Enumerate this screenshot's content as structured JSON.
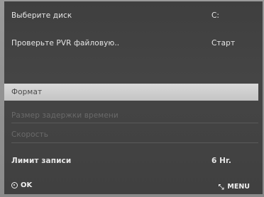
{
  "menu": {
    "rows": [
      {
        "label": "Выберите диск",
        "value": "C:"
      },
      {
        "label": "Проверьте PVR файловую..",
        "value": "Старт"
      },
      {
        "label": "",
        "value": ""
      },
      {
        "label": "Формат",
        "value": ""
      },
      {
        "label": "Размер задержки времени",
        "value": ""
      },
      {
        "label": "Скорость",
        "value": ""
      },
      {
        "label": "Лимит записи",
        "value": "6 Hr."
      }
    ]
  },
  "footer": {
    "ok_label": "OK",
    "menu_label": "MENU"
  },
  "colors": {
    "panel_bg": "#404040",
    "highlight_bg": "#d0d0d0",
    "text": "#e6e6e6",
    "disabled_text": "#6a6a6a"
  }
}
